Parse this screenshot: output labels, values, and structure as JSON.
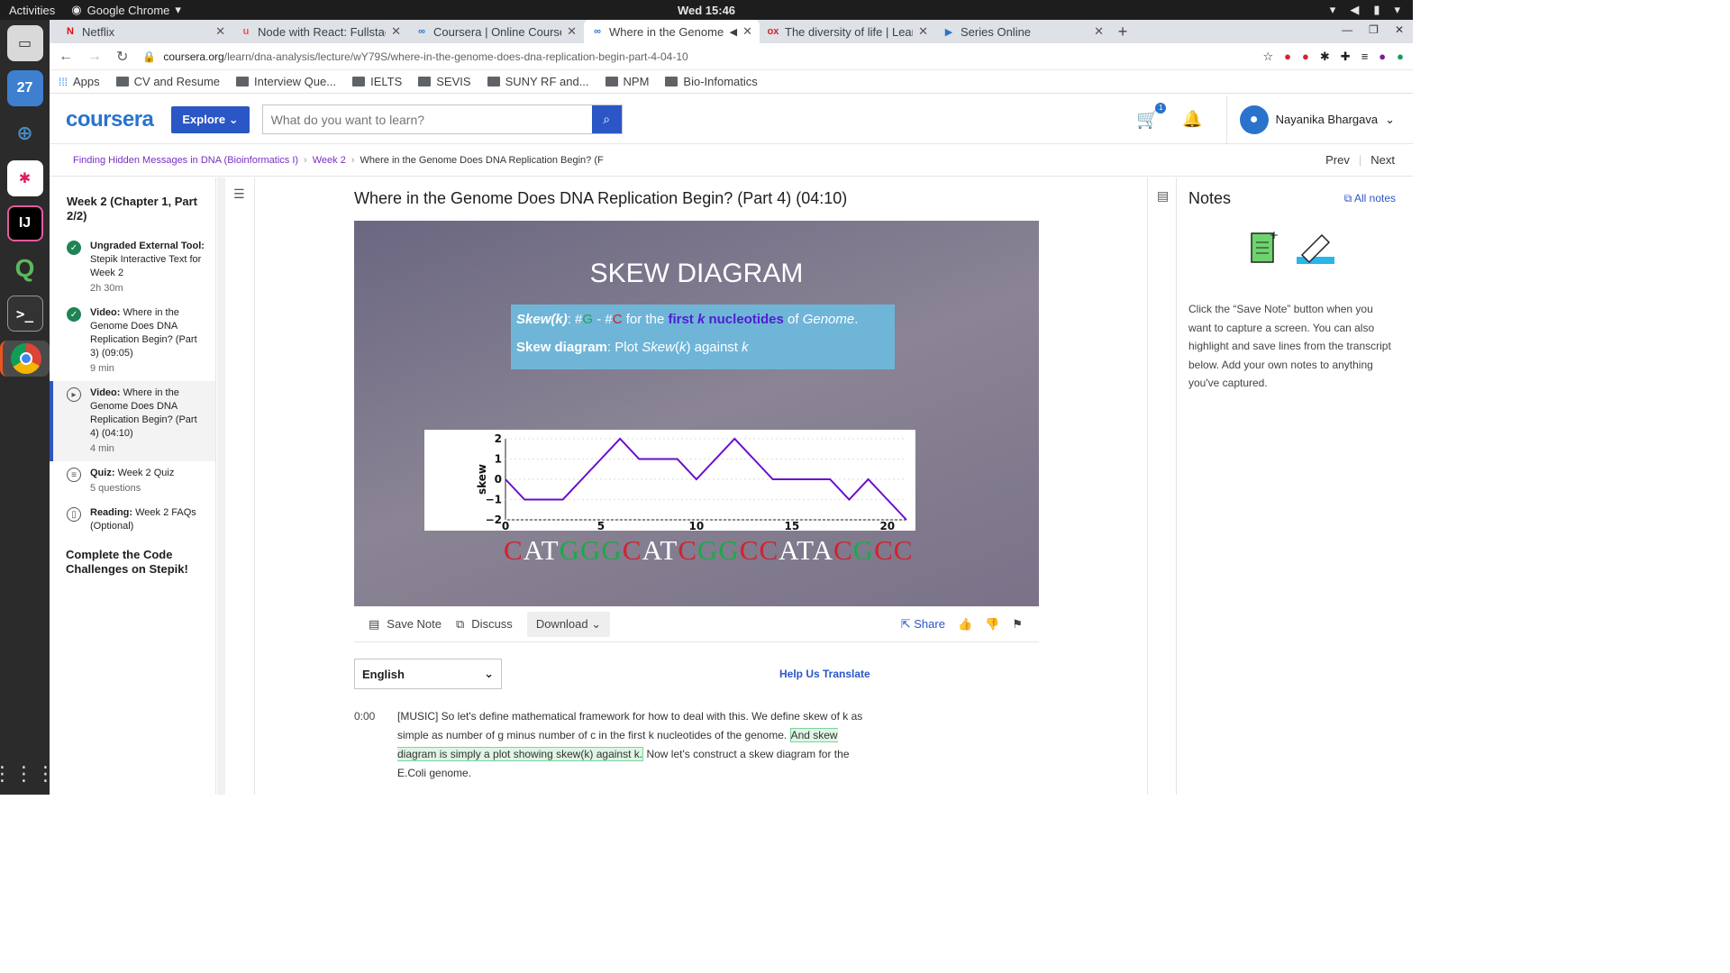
{
  "os": {
    "activities": "Activities",
    "app_name": "Google Chrome",
    "clock": "Wed 15:46",
    "dock_calendar": "27",
    "dock_ide": "IJ"
  },
  "tabs": [
    {
      "label": "Netflix",
      "fav": "N",
      "favcolor": "#e50914"
    },
    {
      "label": "Node with React: Fullstac",
      "fav": "u",
      "favcolor": "#ea5252"
    },
    {
      "label": "Coursera | Online Courses",
      "fav": "∞",
      "favcolor": "#2a73cc"
    },
    {
      "label": "Where in the Genome",
      "fav": "∞",
      "favcolor": "#2a73cc"
    },
    {
      "label": "The diversity of life | Learn",
      "fav": "ox",
      "favcolor": "#d2222d"
    },
    {
      "label": "Series Online",
      "fav": "▶",
      "favcolor": "#2a73cc"
    }
  ],
  "url": {
    "host": "coursera.org",
    "path": "/learn/dna-analysis/lecture/wY79S/where-in-the-genome-does-dna-replication-begin-part-4-04-10"
  },
  "bookmarks": [
    "Apps",
    "CV and Resume",
    "Interview Que...",
    "IELTS",
    "SEVIS",
    "SUNY RF and...",
    "NPM",
    "Bio-Infomatics"
  ],
  "header": {
    "logo": "coursera",
    "explore": "Explore",
    "search_placeholder": "What do you want to learn?",
    "cart_count": "1",
    "user_name": "Nayanika Bhargava"
  },
  "breadcrumb": {
    "course": "Finding Hidden Messages in DNA (Bioinformatics I)",
    "week": "Week 2",
    "current": "Where in the Genome Does DNA Replication Begin? (F",
    "prev": "Prev",
    "next": "Next"
  },
  "sidebar": {
    "week_title": "Week 2 (Chapter 1, Part 2/2)",
    "items": [
      {
        "kind": "Ungraded External Tool:",
        "title": "Stepik Interactive Text for Week 2",
        "meta": "2h 30m"
      },
      {
        "kind": "Video:",
        "title": "Where in the Genome Does DNA Replication Begin? (Part 3) (09:05)",
        "meta": "9 min"
      },
      {
        "kind": "Video:",
        "title": "Where in the Genome Does DNA Replication Begin? (Part 4) (04:10)",
        "meta": "4 min"
      },
      {
        "kind": "Quiz:",
        "title": "Week 2 Quiz",
        "meta": "5 questions"
      },
      {
        "kind": "Reading:",
        "title": "Week 2 FAQs (Optional)",
        "meta": ""
      }
    ],
    "cta": "Complete the Code Challenges on Stepik!"
  },
  "video": {
    "title": "Where in the Genome Does DNA Replication Begin? (Part 4) (04:10)",
    "slide_title": "SKEW DIAGRAM",
    "sequence": "CATGGGCATCGGCCATACGCC"
  },
  "chart_data": {
    "type": "line",
    "title": "",
    "xlabel": "",
    "ylabel": "skew",
    "x": [
      0,
      1,
      2,
      3,
      4,
      5,
      6,
      7,
      8,
      9,
      10,
      11,
      12,
      13,
      14,
      15,
      16,
      17,
      18,
      19,
      20,
      21
    ],
    "series": [
      {
        "values": [
          0,
          -1,
          -1,
          -1,
          0,
          1,
          2,
          1,
          1,
          1,
          0,
          1,
          2,
          1,
          0,
          0,
          0,
          0,
          -1,
          0,
          -1,
          -2
        ]
      }
    ],
    "xticks": [
      "0",
      "5",
      "10",
      "15",
      "20"
    ],
    "yticks": [
      "2",
      "1",
      "0",
      "−1",
      "−2"
    ],
    "xlim": [
      0,
      21
    ],
    "ylim": [
      -2,
      2
    ],
    "color": "#6a0dcc"
  },
  "toolbar": {
    "save_note": "Save Note",
    "discuss": "Discuss",
    "download": "Download",
    "share": "Share"
  },
  "transcript": {
    "language": "English",
    "help": "Help Us Translate",
    "timestamp": "0:00",
    "text_before": "[MUSIC] So let's define mathematical framework for how to deal with this. We define skew of k as simple as number of g minus number of c in the first k nucleotides of the genome. ",
    "text_highlight": "And skew diagram is simply a plot showing skew(k) against k.",
    "text_after": " Now let's construct a skew diagram for the E.Coli genome."
  },
  "notes": {
    "title": "Notes",
    "all_notes": "All notes",
    "help": "Click the “Save Note” button when you want to capture a screen. You can also highlight and save lines from the transcript below. Add your own notes to anything you've captured."
  }
}
